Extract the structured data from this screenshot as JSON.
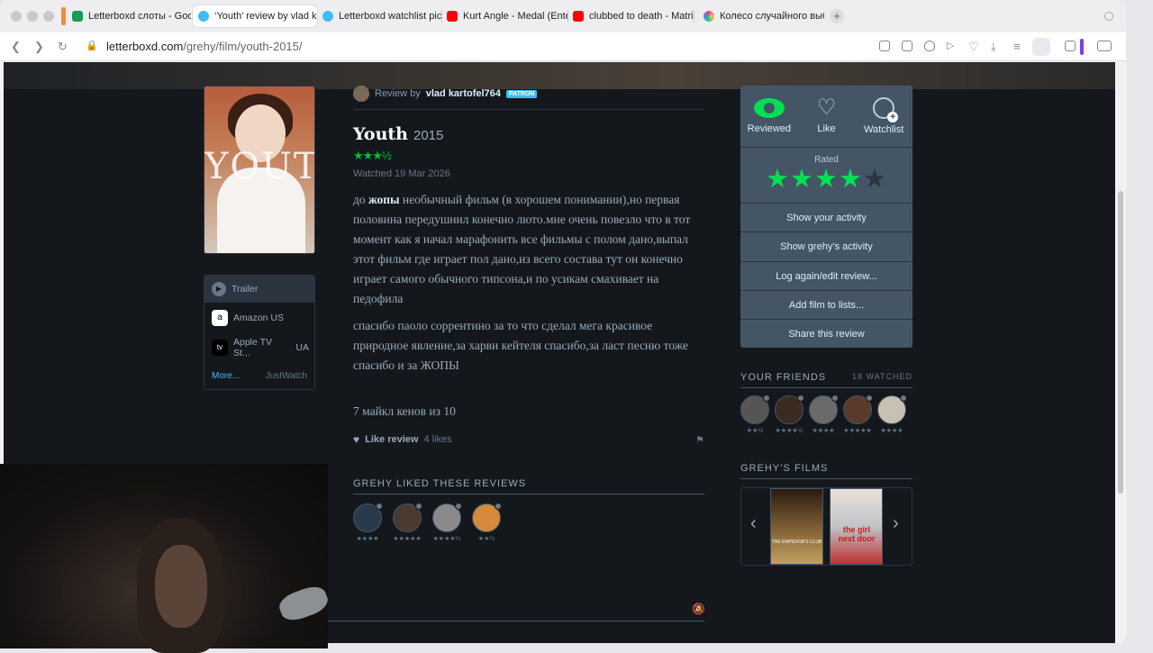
{
  "browser": {
    "tabs": [
      {
        "title": "Letterboxd слоты - Goog",
        "favicon_color": "#0f9d58",
        "active": false
      },
      {
        "title": "‘Youth’ review by vlad ka",
        "favicon_color": "#40bcf4",
        "active": true
      },
      {
        "title": "Letterboxd watchlist pic",
        "favicon_color": "#40bcf4",
        "active": false
      },
      {
        "title": "Kurt Angle - Medal (Ente",
        "favicon_color": "#ff0000",
        "active": false
      },
      {
        "title": "clubbed to death - Matri",
        "favicon_color": "#ff0000",
        "active": false
      },
      {
        "title": "Колесо случайного выб",
        "favicon_color": "#e84393",
        "active": false
      }
    ],
    "new_tab_label": "+",
    "url_host": "letterboxd.com",
    "url_path": "/grehy/film/youth-2015/"
  },
  "film": {
    "poster_text": "YOUTH",
    "title": "Youth",
    "year": "2015",
    "rating_stars": "★★★½",
    "watched": "Watched 19 Mar 2026"
  },
  "review": {
    "byline_prefix": "Review by",
    "author": "vlad kartofel764",
    "patron_badge": "PATRON",
    "para1_pre": "до ",
    "para1_bold": "жопы",
    "para1_rest": " необычный фильм (в хорошем понимании),но первая половина передушнил конечно люто.мне очень повезло что в тот момент как я начал марафонить все фильмы с полом дано,выпал этот фильм где играет пол дано,из всего состава тут он конечно играет самого обычного типсона,и по усикам смахивает на педофила",
    "para2": "спасибо паоло соррентино за то что сделал мега красивое природное явление,за харви кейтеля спасибо,за ласт песню тоже спасибо и за ЖОПЫ",
    "score": "7 майкл кенов из 10",
    "like_label": "Like review",
    "likes_count": "4 likes"
  },
  "where_to_watch": {
    "trailer": "Trailer",
    "providers": [
      {
        "icon": "a",
        "name": "Amazon US",
        "region": ""
      },
      {
        "icon": "tv",
        "name": "Apple TV St...",
        "region": "UA"
      }
    ],
    "more": "More...",
    "justwatch": "JustWatch"
  },
  "liked": {
    "heading": "GREHY LIKED THESE REVIEWS",
    "items": [
      {
        "stars": "★★★★",
        "color": "#2a3a4a"
      },
      {
        "stars": "★★★★★",
        "color": "#4a3a30"
      },
      {
        "stars": "★★★★½",
        "color": "#8a8a8a"
      },
      {
        "stars": "★★½",
        "color": "#d48a3a"
      }
    ]
  },
  "panel": {
    "reviewed": "Reviewed",
    "like": "Like",
    "watchlist": "Watchlist",
    "rated_label": "Rated",
    "rated_stars": "★★★★",
    "rated_off": "★",
    "menu": [
      "Show your activity",
      "Show grehy’s activity",
      "Log again/edit review...",
      "Add film to lists...",
      "Share this review"
    ]
  },
  "friends": {
    "heading": "YOUR FRIENDS",
    "count": "18 WATCHED",
    "items": [
      {
        "stars": "★★½",
        "color": "#555"
      },
      {
        "stars": "★★★★½",
        "color": "#3a2a20"
      },
      {
        "stars": "★★★★",
        "color": "#6a6a6a"
      },
      {
        "stars": "★★★★★",
        "color": "#5a3a2a"
      },
      {
        "stars": "★★★★",
        "color": "#c8c0b0"
      }
    ]
  },
  "films": {
    "heading": "GREHY’S FILMS",
    "posters": [
      {
        "label": "THE EMPEROR'S CLUB",
        "color": "#8a6a3a"
      },
      {
        "label": "the girl next door",
        "color": "#c0c4c8"
      }
    ]
  }
}
